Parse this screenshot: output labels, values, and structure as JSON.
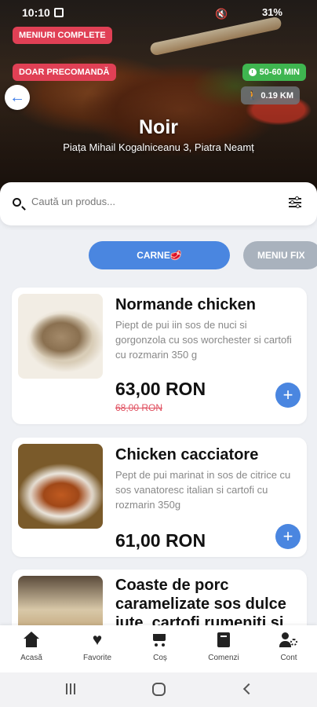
{
  "status_bar": {
    "time": "10:10",
    "battery": "31%"
  },
  "hero": {
    "badge_complete_menus": "MENIURI COMPLETE",
    "badge_preorder": "DOAR PRECOMANDĂ",
    "delivery_time": "50-60 MIN",
    "distance": "0.19 KM",
    "restaurant_name": "Noir",
    "address": "Piața Mihail Kogalniceanu 3, Piatra Neamț"
  },
  "search": {
    "placeholder": "Caută un produs..."
  },
  "categories": [
    {
      "label": "CARNE🥩",
      "active": true
    },
    {
      "label": "MENIU FIX",
      "active": false
    }
  ],
  "products": [
    {
      "name": "Normande chicken",
      "description": "Piept de pui iin sos de nuci si gorgonzola cu sos worchester si cartofi cu rozmarin 350 g",
      "price": "63,00 RON",
      "old_price": "68,00 RON"
    },
    {
      "name": "Chicken cacciatore",
      "description": "Pept de pui marinat in sos de citrice cu sos vanatoresc italian si cartofi cu rozmarin 350g",
      "price": "61,00 RON"
    },
    {
      "name": "Coaste de porc caramelizate sos dulce iute, cartofi rumeniti si"
    }
  ],
  "bottom_nav": [
    {
      "label": "Acasă",
      "icon": "home-icon"
    },
    {
      "label": "Favorite",
      "icon": "heart-icon"
    },
    {
      "label": "Coș",
      "icon": "cart-icon"
    },
    {
      "label": "Comenzi",
      "icon": "book-icon"
    },
    {
      "label": "Cont",
      "icon": "user-settings-icon"
    }
  ],
  "colors": {
    "accent": "#4a86e0",
    "badge_red": "#e04055",
    "badge_green": "#3fb650",
    "old_price": "#e05060"
  }
}
